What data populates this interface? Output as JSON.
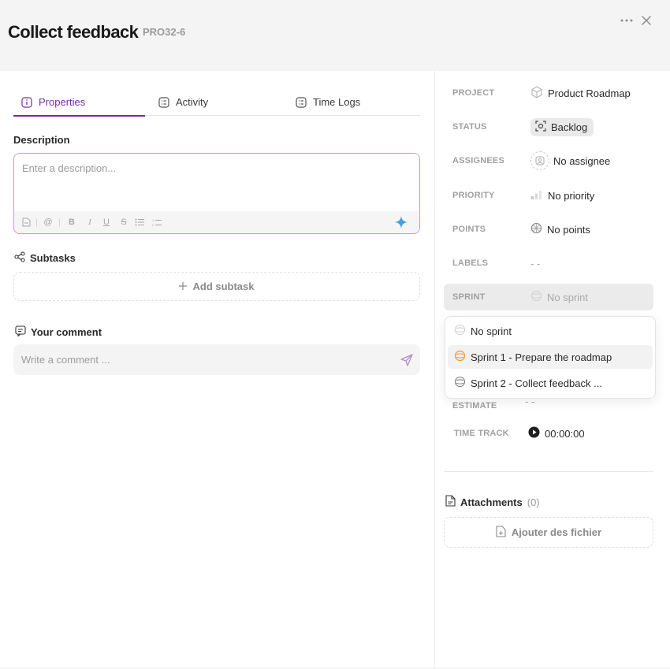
{
  "header": {
    "title": "Collect feedback",
    "code": "PRO32-6",
    "more_icon": "more-horizontal-icon",
    "close_icon": "close-icon"
  },
  "tabs": [
    {
      "label": "Properties",
      "icon": "info-icon",
      "active": true
    },
    {
      "label": "Activity",
      "icon": "list-icon",
      "active": false
    },
    {
      "label": "Time Logs",
      "icon": "list-icon",
      "active": false
    }
  ],
  "description": {
    "label": "Description",
    "placeholder": "Enter a description...",
    "toolbar": [
      "file-icon",
      "mention-icon",
      "bold-icon",
      "italic-icon",
      "underline-icon",
      "strikethrough-icon",
      "bullet-list-icon",
      "numbered-list-icon",
      "ai-sparkle-icon"
    ]
  },
  "subtasks": {
    "label": "Subtasks",
    "add_label": "Add subtask"
  },
  "comment": {
    "label": "Your comment",
    "placeholder": "Write a comment ..."
  },
  "properties": {
    "project": {
      "label": "PROJECT",
      "value": "Product Roadmap"
    },
    "status": {
      "label": "STATUS",
      "value": "Backlog"
    },
    "assignees": {
      "label": "ASSIGNEES",
      "value": "No assignee"
    },
    "priority": {
      "label": "PRIORITY",
      "value": "No priority"
    },
    "points": {
      "label": "POINTS",
      "value": "No points"
    },
    "labels": {
      "label": "LABELS",
      "value": "- -"
    },
    "sprint": {
      "label": "SPRINT",
      "value": "No sprint"
    },
    "estimate": {
      "label": "ESTIMATE",
      "value": "- -"
    },
    "time_track": {
      "label": "TIME TRACK",
      "value": "00:00:00"
    }
  },
  "sprint_dropdown": {
    "options": [
      {
        "label": "No sprint"
      },
      {
        "label": "Sprint 1 - Prepare the roadmap"
      },
      {
        "label": "Sprint 2 - Collect feedback ..."
      }
    ]
  },
  "attachments": {
    "label": "Attachments",
    "count": "(0)",
    "add_label": "Ajouter des fichier"
  },
  "colors": {
    "accent": "#7a2aa6",
    "sprint_active": "#e89a2e",
    "ai_sparkle": "#4a9fd6"
  }
}
